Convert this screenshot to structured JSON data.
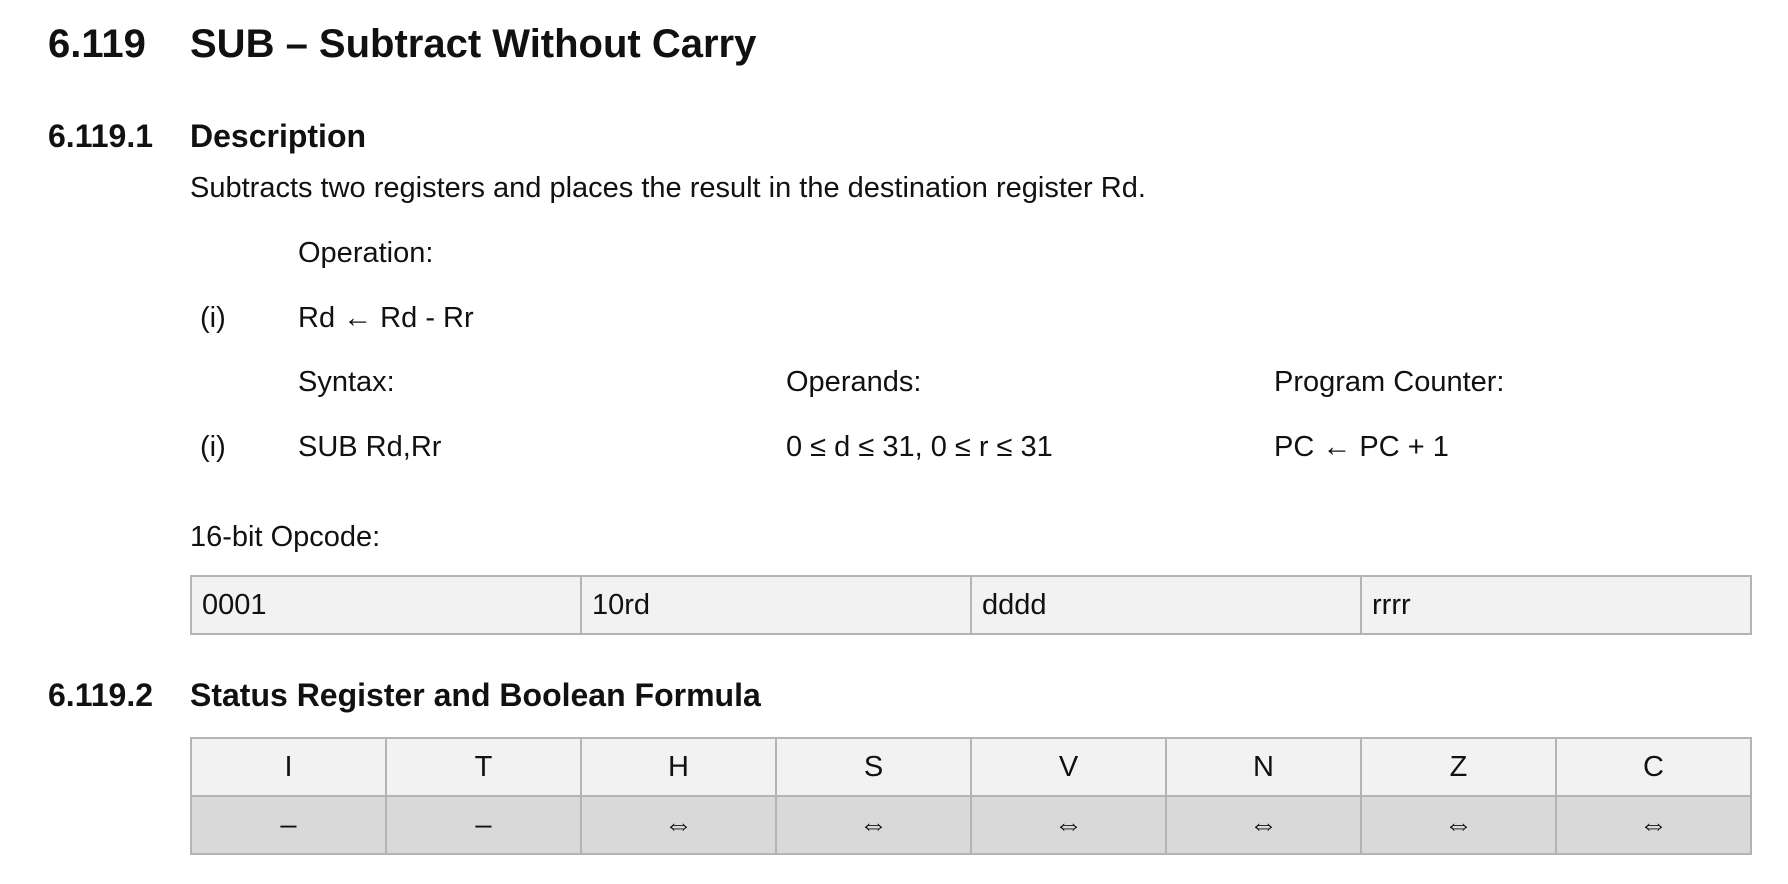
{
  "heading": {
    "number": "6.119",
    "title": "SUB – Subtract Without Carry"
  },
  "description": {
    "number": "6.119.1",
    "title": "Description",
    "text": "Subtracts two registers and places the result in the destination register Rd.",
    "operation_label": "Operation:",
    "operation_index": "(i)",
    "operation_formula": "Rd ← Rd - Rr",
    "syntax_label": "Syntax:",
    "operands_label": "Operands:",
    "pc_label": "Program Counter:",
    "syntax_index": "(i)",
    "syntax_value": "SUB Rd,Rr",
    "operands_value": "0 ≤ d ≤ 31, 0 ≤ r ≤ 31",
    "pc_value": "PC ← PC + 1",
    "opcode_label": "16-bit Opcode:",
    "opcode": [
      "0001",
      "10rd",
      "dddd",
      "rrrr"
    ]
  },
  "status": {
    "number": "6.119.2",
    "title": "Status Register and Boolean Formula",
    "flags": [
      "I",
      "T",
      "H",
      "S",
      "V",
      "N",
      "Z",
      "C"
    ],
    "values": [
      "–",
      "–",
      "⇔",
      "⇔",
      "⇔",
      "⇔",
      "⇔",
      "⇔"
    ]
  }
}
